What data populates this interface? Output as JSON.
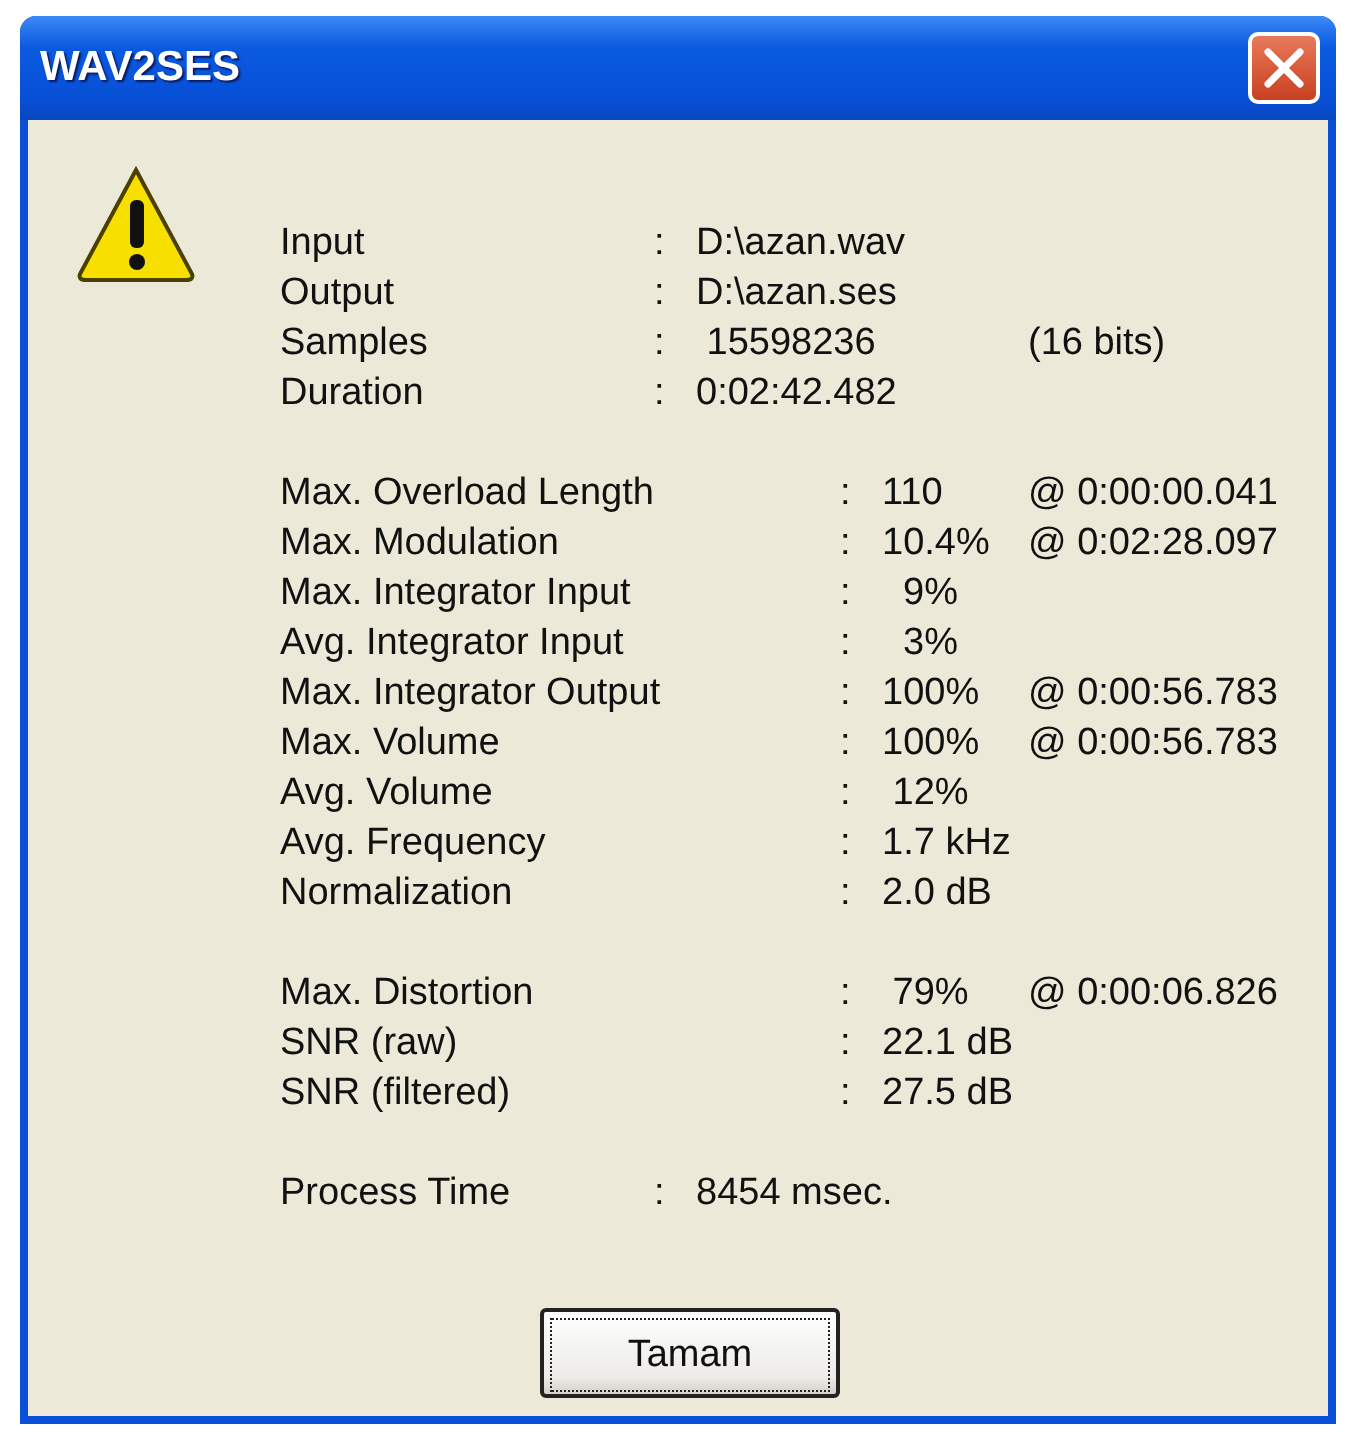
{
  "window": {
    "title": "WAV2SES"
  },
  "sections": [
    {
      "kind": "short",
      "rows": [
        {
          "label": "Input",
          "sep": ":",
          "value": "D:\\azan.wav"
        },
        {
          "label": "Output",
          "sep": ":",
          "value": "D:\\azan.ses"
        },
        {
          "label": "Samples",
          "sep": ":",
          "value": " 15598236",
          "extra": "(16 bits)"
        },
        {
          "label": "Duration",
          "sep": ":",
          "value": "0:02:42.482"
        }
      ]
    },
    {
      "kind": "long",
      "rows": [
        {
          "label": "Max. Overload Length",
          "sep": ":",
          "value": "110",
          "extra": "@ 0:00:00.041"
        },
        {
          "label": "Max. Modulation",
          "sep": ":",
          "value": "10.4%",
          "extra": "@ 0:02:28.097"
        },
        {
          "label": "Max. Integrator Input",
          "sep": ":",
          "value": "  9%"
        },
        {
          "label": "Avg. Integrator Input",
          "sep": ":",
          "value": "  3%"
        },
        {
          "label": "Max. Integrator Output",
          "sep": ":",
          "value": "100%",
          "extra": "@ 0:00:56.783"
        },
        {
          "label": "Max. Volume",
          "sep": ":",
          "value": "100%",
          "extra": "@ 0:00:56.783"
        },
        {
          "label": "Avg. Volume",
          "sep": ":",
          "value": " 12%"
        },
        {
          "label": "Avg. Frequency",
          "sep": ":",
          "value": "1.7 kHz"
        },
        {
          "label": "Normalization",
          "sep": ":",
          "value": "2.0 dB"
        }
      ]
    },
    {
      "kind": "long",
      "rows": [
        {
          "label": "Max. Distortion",
          "sep": ":",
          "value": " 79%",
          "extra": "@ 0:00:06.826"
        },
        {
          "label": "SNR (raw)",
          "sep": ":",
          "value": "22.1 dB"
        },
        {
          "label": "SNR (filtered)",
          "sep": ":",
          "value": "27.5 dB"
        }
      ]
    },
    {
      "kind": "short",
      "rows": [
        {
          "label": "Process Time",
          "sep": ":",
          "value": "8454 msec."
        }
      ]
    }
  ],
  "buttons": [
    {
      "label": "Tamam",
      "focused": true
    }
  ]
}
